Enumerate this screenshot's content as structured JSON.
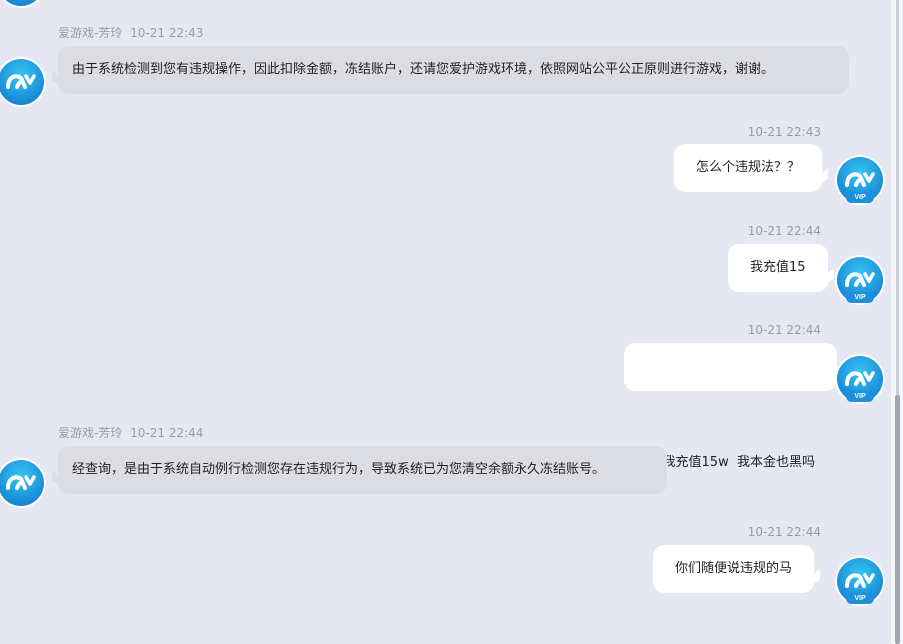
{
  "agent": {
    "name": "爱游戏-芳玲"
  },
  "user": {
    "badge": "VIP"
  },
  "messages": [
    {
      "side": "left",
      "time": "10-21 22:43",
      "text": "由于系统检测到您有违规操作，因此扣除金额，冻结账户，还请您爱护游戏环境，依照网站公平公正原则进行游戏，谢谢。"
    },
    {
      "side": "right",
      "time": "10-21 22:43",
      "text": "怎么个违规法？？"
    },
    {
      "side": "right",
      "time": "10-21 22:44",
      "text": "我充值15"
    },
    {
      "side": "right",
      "time": "10-21 22:44",
      "text": "我充值15w  我本金也黑吗"
    },
    {
      "side": "left",
      "time": "10-21 22:44",
      "text": "经查询，是由于系统自动例行检测您存在违规行为，导致系统已为您清空余额永久冻结账号。"
    },
    {
      "side": "right",
      "time": "10-21 22:44",
      "text": "你们随便说违规的马"
    }
  ],
  "colors": {
    "background": "#e5e8f3",
    "agent_bubble": "#dcdde3",
    "user_bubble": "#ffffff",
    "avatar": "#1d93db"
  },
  "icons": {
    "avatar": "ay-logo-icon"
  }
}
